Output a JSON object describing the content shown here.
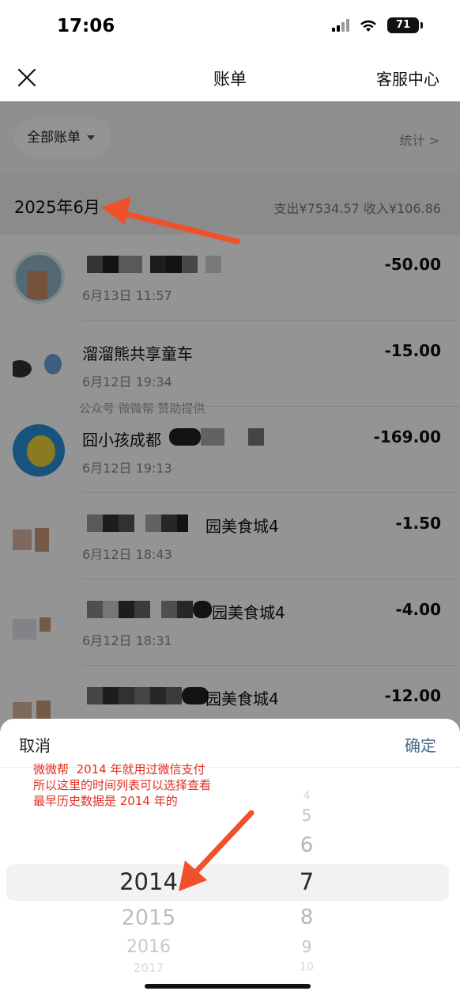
{
  "status_bar": {
    "time": "17:06",
    "battery": "71"
  },
  "nav": {
    "title": "账单",
    "service": "客服中心"
  },
  "filter": {
    "all_bills": "全部账单",
    "stats": "统计 >"
  },
  "month_row": {
    "month": "2025年6月",
    "summary": "支出¥7534.57  收入¥106.86"
  },
  "transactions": [
    {
      "name": "",
      "datetime": "6月13日 11:57",
      "amount": "-50.00"
    },
    {
      "name": "溜溜熊共享童车",
      "datetime": "6月12日 19:34",
      "amount": "-15.00"
    },
    {
      "name": "囧小孩成都",
      "datetime": "6月12日 19:13",
      "amount": "-169.00"
    },
    {
      "name": "园美食城4",
      "datetime": "6月12日 18:43",
      "amount": "-1.50"
    },
    {
      "name": "园美食城4",
      "datetime": "6月12日 18:31",
      "amount": "-4.00"
    },
    {
      "name": "园美食城4",
      "datetime": "",
      "amount": "-12.00"
    }
  ],
  "watermark": "公众号 微微帮  赞助提供",
  "sheet": {
    "cancel": "取消",
    "confirm": "确定",
    "annotation": "微微帮  2014 年就用过微信支付\n所以这里的时间列表可以选择查看\n最早历史数据是 2014 年的"
  },
  "picker": {
    "years": [
      "2014",
      "2015",
      "2016",
      "2017"
    ],
    "months": [
      "4",
      "5",
      "6",
      "7",
      "8",
      "9",
      "10"
    ]
  },
  "colors": {
    "annotation_red": "#e32d1f",
    "arrow": "#f0502a",
    "confirm_blue": "#4a6a8e"
  }
}
